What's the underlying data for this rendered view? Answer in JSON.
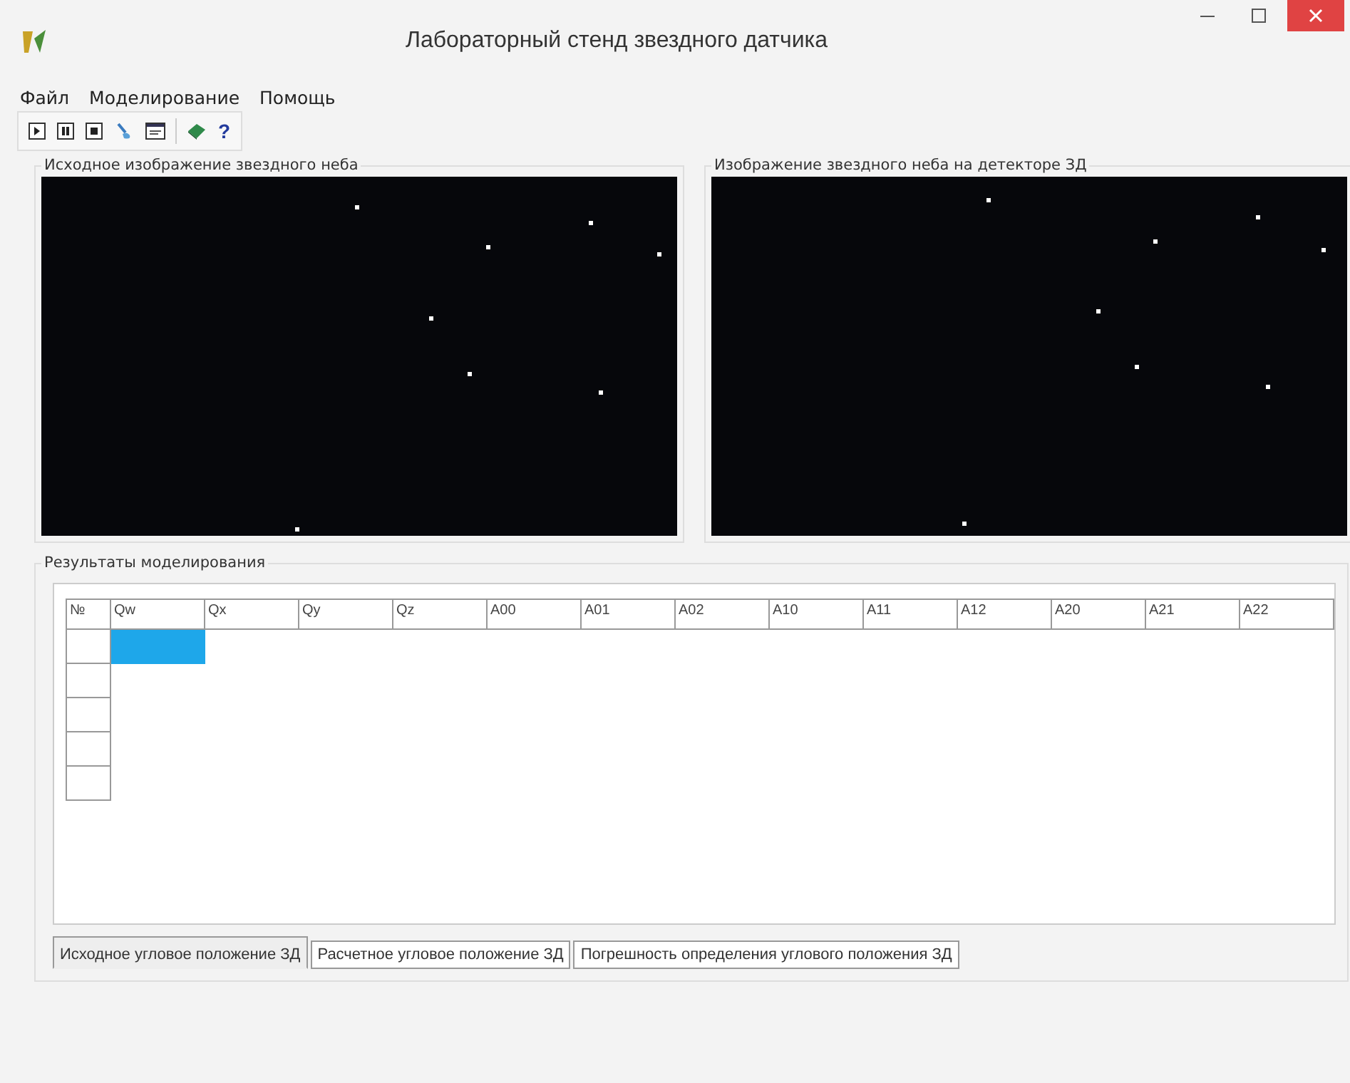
{
  "window": {
    "title": "Лабораторный стенд звездного датчика"
  },
  "menu": [
    "Файл",
    "Моделирование",
    "Помощь"
  ],
  "toolbar": {
    "help_label": "?"
  },
  "panels": [
    {
      "title": "Исходное изображение звездного неба"
    },
    {
      "title": "Изображение звездного неба на детекторе ЗД"
    }
  ],
  "results": {
    "title": "Результаты моделирования",
    "columns": [
      "№",
      "Qw",
      "Qx",
      "Qy",
      "Qz",
      "A00",
      "A01",
      "A02",
      "A10",
      "A11",
      "A12",
      "A20",
      "A21",
      "A22"
    ],
    "rows": [
      {
        "selected": true
      },
      {
        "selected": false
      },
      {
        "selected": false
      },
      {
        "selected": false
      },
      {
        "selected": false
      }
    ],
    "tabs": [
      {
        "label": "Исходное угловое положение ЗД",
        "selected": true
      },
      {
        "label": "Расчетное угловое положение ЗД",
        "selected": false
      },
      {
        "label": "Погрешность определения углового положения ЗД",
        "selected": false
      }
    ]
  }
}
